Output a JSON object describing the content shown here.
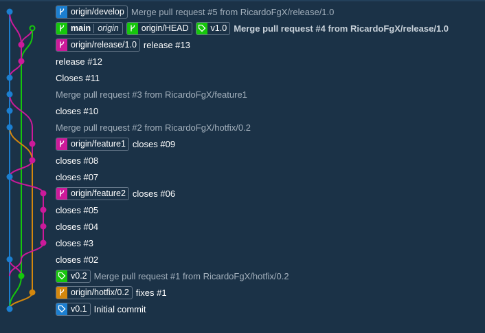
{
  "colors": {
    "background": "#1b3247",
    "lane_blue": "#1c7fd0",
    "lane_green": "#16c60c",
    "lane_magenta": "#cc1a9a",
    "lane_orange": "#d4870d",
    "badge_border": "#66788a"
  },
  "commits": [
    {
      "badges": [
        {
          "icon": "branch-icon",
          "color": "blue",
          "label": "origin/develop"
        }
      ],
      "message": "Merge pull request #5 from RicardoFgX/release/1.0",
      "message_style": "dim"
    },
    {
      "badges": [
        {
          "icon": "branch-icon",
          "color": "green",
          "label": "main",
          "remote": "origin"
        },
        {
          "icon": "branch-icon",
          "color": "green",
          "label": "origin/HEAD"
        },
        {
          "icon": "tag-icon",
          "color": "green",
          "label": "v1.0"
        }
      ],
      "message": "Merge pull request #4 from RicardoFgX/release/1.0",
      "message_style": "bold",
      "is_head": true
    },
    {
      "badges": [
        {
          "icon": "branch-icon",
          "color": "magenta",
          "label": "origin/release/1.0"
        }
      ],
      "message": "release #13",
      "message_style": "normal"
    },
    {
      "badges": [],
      "message": "release #12",
      "message_style": "normal"
    },
    {
      "badges": [],
      "message": "Closes #11",
      "message_style": "normal"
    },
    {
      "badges": [],
      "message": "Merge pull request #3 from RicardoFgX/feature1",
      "message_style": "dim"
    },
    {
      "badges": [],
      "message": "closes #10",
      "message_style": "normal"
    },
    {
      "badges": [],
      "message": "Merge pull request #2 from RicardoFgX/hotfix/0.2",
      "message_style": "dim"
    },
    {
      "badges": [
        {
          "icon": "branch-icon",
          "color": "magenta",
          "label": "origin/feature1"
        }
      ],
      "message": "closes #09",
      "message_style": "normal"
    },
    {
      "badges": [],
      "message": "closes #08",
      "message_style": "normal"
    },
    {
      "badges": [],
      "message": "closes #07",
      "message_style": "normal"
    },
    {
      "badges": [
        {
          "icon": "branch-icon",
          "color": "magenta",
          "label": "origin/feature2"
        }
      ],
      "message": "closes #06",
      "message_style": "normal"
    },
    {
      "badges": [],
      "message": "closes #05",
      "message_style": "normal"
    },
    {
      "badges": [],
      "message": "closes #04",
      "message_style": "normal"
    },
    {
      "badges": [],
      "message": "closes #3",
      "message_style": "normal"
    },
    {
      "badges": [],
      "message": "closes #02",
      "message_style": "normal"
    },
    {
      "badges": [
        {
          "icon": "tag-icon",
          "color": "green",
          "label": "v0.2"
        }
      ],
      "message": "Merge pull request #1 from RicardoFgX/hotfix/0.2",
      "message_style": "dim"
    },
    {
      "badges": [
        {
          "icon": "branch-icon",
          "color": "orange",
          "label": "origin/hotfix/0.2"
        }
      ],
      "message": "fixes #1",
      "message_style": "normal"
    },
    {
      "badges": [
        {
          "icon": "tag-icon",
          "color": "blue",
          "label": "v0.1"
        }
      ],
      "message": "Initial commit",
      "message_style": "normal"
    }
  ]
}
